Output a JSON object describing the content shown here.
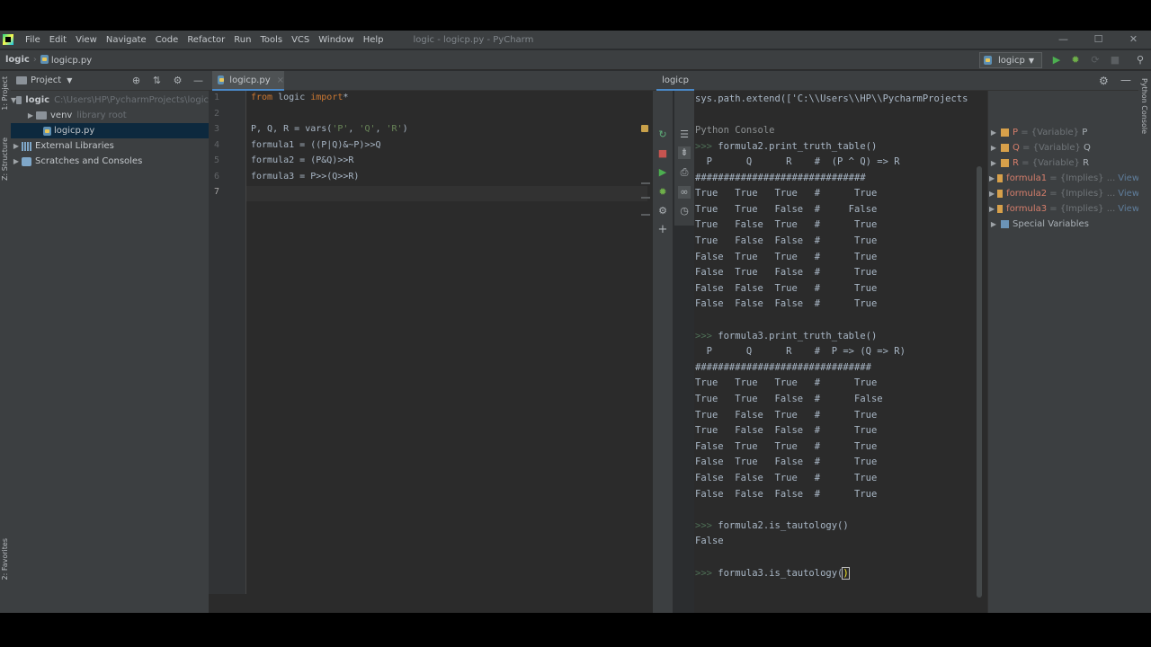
{
  "menu": {
    "items": [
      "File",
      "Edit",
      "View",
      "Navigate",
      "Code",
      "Refactor",
      "Run",
      "Tools",
      "VCS",
      "Window",
      "Help"
    ],
    "window_title": "logic - logicp.py - PyCharm",
    "window_buttons": [
      "—",
      "☐",
      "✕"
    ]
  },
  "nav": {
    "project_crumb": "logic",
    "file_crumb": "logicp.py",
    "run_config": "logicp"
  },
  "tool_strip": {
    "project": "1: Project",
    "structure": "Z: Structure",
    "favorites": "2: Favorites",
    "python_console": "Python Console"
  },
  "project_panel": {
    "title": "Project",
    "root_name": "logic",
    "root_path": "C:\\Users\\HP\\PycharmProjects\\logic",
    "venv_name": "venv",
    "venv_tag": "library root",
    "file_name": "logicp.py",
    "external_libraries": "External Libraries",
    "scratches": "Scratches and Consoles"
  },
  "editor": {
    "tab_label": "logicp.py",
    "line_numbers": [
      "1",
      "2",
      "3",
      "4",
      "5",
      "6",
      "7"
    ],
    "lines": {
      "l1_kw1": "from",
      "l1_mid": " logic ",
      "l1_kw2": "import",
      "l1_end": "*",
      "l3_a": "P, Q, R = vars(",
      "l3_s1": "'P'",
      "l3_c1": ", ",
      "l3_s2": "'Q'",
      "l3_c2": ", ",
      "l3_s3": "'R'",
      "l3_e": ")",
      "l4": "formula1 = ((P|Q)&~P)>>Q",
      "l5": "formula2 = (P&Q)>>R",
      "l6": "formula3 = P>>(Q>>R)"
    }
  },
  "console": {
    "tab_label": "logicp",
    "sys_path_line": "sys.path.extend(['C:\\\\Users\\\\HP\\\\PycharmProjects",
    "section": "Python Console",
    "prompt": ">>>",
    "cmd1": " formula2.print_truth_table()",
    "header1": "  P      Q      R    #  (P ^ Q) => R",
    "rule1": "##############################",
    "rows1": [
      "True   True   True   #      True",
      "True   True   False  #     False",
      "True   False  True   #      True",
      "True   False  False  #      True",
      "False  True   True   #      True",
      "False  True   False  #      True",
      "False  False  True   #      True",
      "False  False  False  #      True"
    ],
    "cmd2": " formula3.print_truth_table()",
    "header2": "  P      Q      R    #  P => (Q => R)",
    "rule2": "###############################",
    "rows2": [
      "True   True   True   #      True",
      "True   True   False  #      False",
      "True   False  True   #      True",
      "True   False  False  #      True",
      "False  True   True   #      True",
      "False  True   False  #      True",
      "False  False  True   #      True",
      "False  False  False  #      True"
    ],
    "cmd3": " formula2.is_tautology()",
    "result3": "False",
    "cmd4_text": " formula3.is_tautology(",
    "cmd4_cursor": ")"
  },
  "variables": [
    {
      "name": "P",
      "type": "{Variable}",
      "value": "P",
      "view": ""
    },
    {
      "name": "Q",
      "type": "{Variable}",
      "value": "Q",
      "view": ""
    },
    {
      "name": "R",
      "type": "{Variable}",
      "value": "R",
      "view": ""
    },
    {
      "name": "formula1",
      "type": "{Implies}",
      "value": "...",
      "view": "View"
    },
    {
      "name": "formula2",
      "type": "{Implies}",
      "value": "...",
      "view": "View"
    },
    {
      "name": "formula3",
      "type": "{Implies}",
      "value": "...",
      "view": "View"
    }
  ],
  "special_variables": "Special Variables",
  "colors": {
    "accent": "#4a88c7",
    "keyword": "#cc7832",
    "string": "#6a8759",
    "run_green": "#4caf50",
    "stop_red": "#c75450",
    "var_name": "#d67e6b"
  }
}
